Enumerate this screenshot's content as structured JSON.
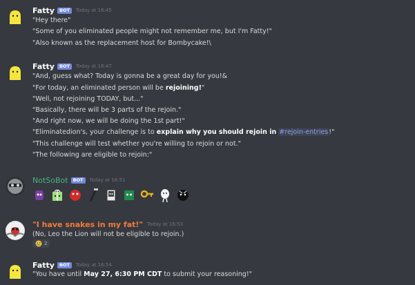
{
  "colors": {
    "background": "#36393f",
    "bot_badge": "#7289da",
    "mention": "#8ea1e1",
    "notsobot_name": "#43b581",
    "snakes_name": "#f47b3a"
  },
  "messages": [
    {
      "author": "Fatty",
      "badge": "BOT",
      "time": "Today at 16:45",
      "lines": [
        "\"Hey there\"",
        "\"Some of you eliminated people might not remember me, but I'm Fatty!\"",
        "\"Also known as the replacement host for Bombycake!\\"
      ]
    },
    {
      "author": "Fatty",
      "badge": "BOT",
      "time": "Today at 16:47",
      "lines": [
        "\"And, guess what? Today is gonna be a great day for you!&",
        "\"For today, an eliminated person will be ",
        "rejoining!",
        "\"",
        "\"Well, not rejoining TODAY, but...\"",
        "\"Basically, there will be 3 parts of the rejoin.\"",
        "\"And right now, we will be doing the 1st part!\"",
        "\"Eliminatedion's, your challenge is to ",
        "explain why you should rejoin in",
        "#rejoin-entries",
        "!\"",
        "\"This challenge will test whether you're willing to rejoin or not.\"",
        "\"The following are eligible to rejoin:\""
      ]
    },
    {
      "author": "NotSoBot",
      "badge": "BOT",
      "time": "Today at 16:51",
      "emojis": [
        "purple-character-emoji",
        "gift-box-character-emoji",
        "red-ball-character-emoji",
        "black-stick-character-emoji",
        "gray-device-character-emoji",
        "green-block-character-emoji",
        "key-character-emoji",
        "white-egg-character-emoji",
        "black-ball-character-emoji"
      ]
    },
    {
      "author": "\"I have snakes in my fat!\"",
      "time": "Today at 16:53",
      "lines": [
        "(No, Leo the Lion will not be eligible to rejoin.)"
      ],
      "reaction": {
        "emoji": "crying-face-emoji",
        "count": "2"
      }
    },
    {
      "author": "Fatty",
      "badge": "BOT",
      "time": "Today at 16:54",
      "lines": [
        "\"You have until ",
        "May 27, 6:30 PM CDT",
        " to submit your reasoning!\""
      ]
    }
  ]
}
